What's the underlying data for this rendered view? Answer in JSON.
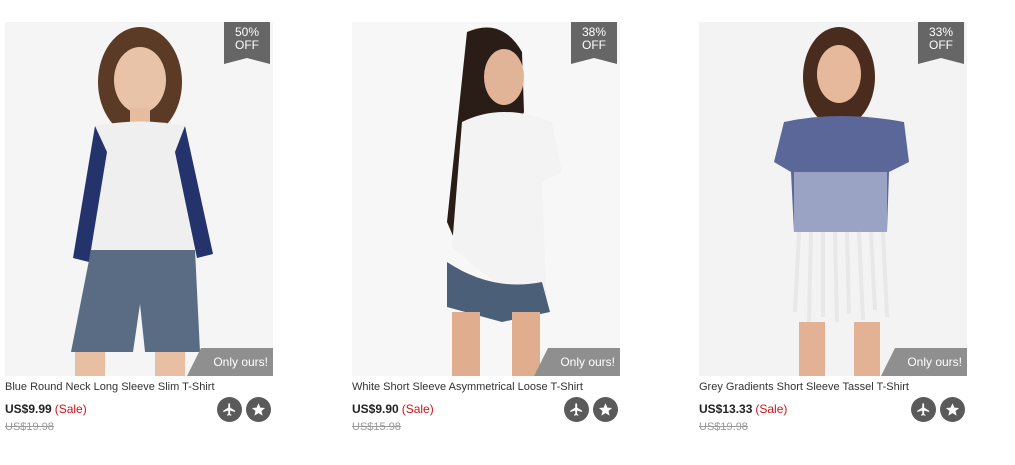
{
  "products": [
    {
      "discount_pct": "50%",
      "discount_off": "OFF",
      "badge": "Only ours!",
      "title": "Blue Round Neck Long Sleeve Slim T-Shirt",
      "price": "US$9.99",
      "sale": "(Sale)",
      "original_price": "US$19.98"
    },
    {
      "discount_pct": "38%",
      "discount_off": "OFF",
      "badge": "Only ours!",
      "title": "White Short Sleeve Asymmetrical Loose T-Shirt",
      "price": "US$9.90",
      "sale": "(Sale)",
      "original_price": "US$15.98"
    },
    {
      "discount_pct": "33%",
      "discount_off": "OFF",
      "badge": "Only ours!",
      "title": "Grey Gradients Short Sleeve Tassel T-Shirt",
      "price": "US$13.33",
      "sale": "(Sale)",
      "original_price": "US$19.98"
    }
  ],
  "icons": {
    "shipping": "airplane-icon",
    "favorite": "star-icon"
  },
  "colors": {
    "sale_red": "#d0121b",
    "badge_grey": "#666666",
    "icon_grey": "#5a5a5a"
  }
}
